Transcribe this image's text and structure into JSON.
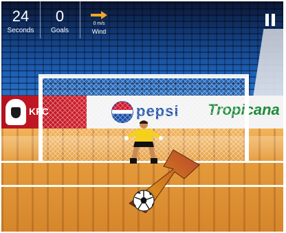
{
  "hud": {
    "time_value": "24",
    "time_label": "Seconds",
    "goals_value": "0",
    "goals_label": "Goals",
    "wind_speed": "0 m/s",
    "wind_label": "Wind",
    "wind_icon": "arrow-right-icon",
    "pause_icon": "pause-icon"
  },
  "ads": {
    "kfc": "KFC",
    "pepsi": "pepsi",
    "tropicana": "Tropicana"
  },
  "colors": {
    "aim_arrow": "#b8452a",
    "wind_arrow": "#f3a625",
    "keeper_shirt": "#f4d11d"
  }
}
